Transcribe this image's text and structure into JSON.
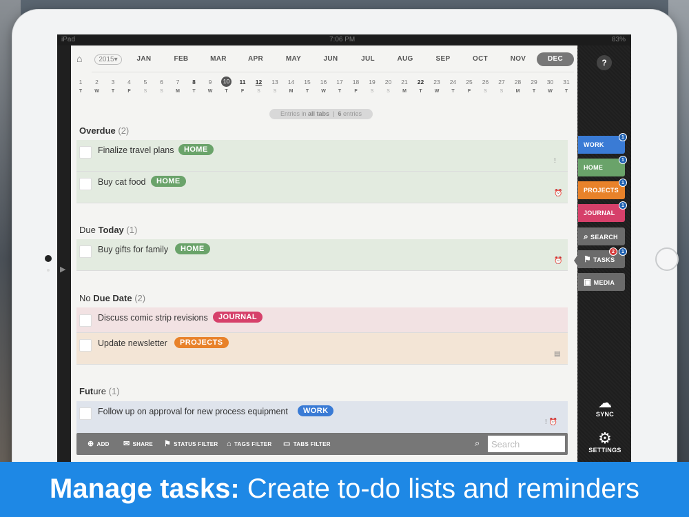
{
  "status": {
    "left": "iPad",
    "time": "7:06 PM",
    "right": "83%"
  },
  "calendar": {
    "home_icon": "home-icon",
    "year": "2015",
    "months": [
      "JAN",
      "FEB",
      "MAR",
      "APR",
      "MAY",
      "JUN",
      "JUL",
      "AUG",
      "SEP",
      "OCT",
      "NOV",
      "DEC"
    ],
    "active_month": "DEC",
    "days": [
      {
        "n": "1",
        "w": "T"
      },
      {
        "n": "2",
        "w": "W"
      },
      {
        "n": "3",
        "w": "T"
      },
      {
        "n": "4",
        "w": "F"
      },
      {
        "n": "5",
        "w": "S"
      },
      {
        "n": "6",
        "w": "S"
      },
      {
        "n": "7",
        "w": "M"
      },
      {
        "n": "8",
        "w": "T"
      },
      {
        "n": "9",
        "w": "W"
      },
      {
        "n": "10",
        "w": "T"
      },
      {
        "n": "11",
        "w": "F"
      },
      {
        "n": "12",
        "w": "S"
      },
      {
        "n": "13",
        "w": "S"
      },
      {
        "n": "14",
        "w": "M"
      },
      {
        "n": "15",
        "w": "T"
      },
      {
        "n": "16",
        "w": "W"
      },
      {
        "n": "17",
        "w": "T"
      },
      {
        "n": "18",
        "w": "F"
      },
      {
        "n": "19",
        "w": "S"
      },
      {
        "n": "20",
        "w": "S"
      },
      {
        "n": "21",
        "w": "M"
      },
      {
        "n": "22",
        "w": "T"
      },
      {
        "n": "23",
        "w": "W"
      },
      {
        "n": "24",
        "w": "T"
      },
      {
        "n": "25",
        "w": "F"
      },
      {
        "n": "26",
        "w": "S"
      },
      {
        "n": "27",
        "w": "S"
      },
      {
        "n": "28",
        "w": "M"
      },
      {
        "n": "29",
        "w": "T"
      },
      {
        "n": "30",
        "w": "W"
      },
      {
        "n": "31",
        "w": "T"
      }
    ]
  },
  "entries": {
    "prefix": "Entries in",
    "scope": "all tabs",
    "sep": "|",
    "count": "6",
    "suffix": "entries"
  },
  "sections": {
    "overdue": {
      "label": "Overdue",
      "count": "(2)"
    },
    "due_today": {
      "label_plain": "Due ",
      "label_bold": "Today",
      "count": "(1)"
    },
    "no_due": {
      "label_plain": "No ",
      "label_bold": "Due Date",
      "count": "(2)"
    },
    "future": {
      "label_bold": "Fut",
      "label_plain": "ure",
      "count": "(1)"
    }
  },
  "tasks": [
    {
      "title": "Finalize travel plans",
      "tag": "HOME",
      "icons": "!"
    },
    {
      "title": "Buy cat food",
      "tag": "HOME",
      "icons": "⏰"
    },
    {
      "title": "Buy gifts for family",
      "tag": "HOME",
      "icons": "⏰"
    },
    {
      "title": "Discuss comic strip revisions",
      "tag": "JOURNAL",
      "icons": ""
    },
    {
      "title": "Update newsletter",
      "tag": "PROJECTS",
      "icons": "▤"
    },
    {
      "title": "Follow up on approval for new process equipment",
      "tag": "WORK",
      "icons": "! ⏰"
    }
  ],
  "toolbar": {
    "add": "ADD",
    "share": "SHARE",
    "status_filter": "STATUS FILTER",
    "tags_filter": "TAGS FILTER",
    "tabs_filter": "TABS FILTER",
    "search_placeholder": "Search"
  },
  "right_tabs": {
    "help": "?",
    "work": "WORK",
    "home": "HOME",
    "projects": "PROJECTS",
    "journal": "JOURNAL",
    "search": "SEARCH",
    "tasks": "TASKS",
    "media": "MEDIA",
    "badges": {
      "work": "1",
      "home": "1",
      "projects": "1",
      "journal": "1",
      "tasks_red": "2",
      "tasks_blue": "1"
    },
    "sync": "SYNC",
    "settings": "SETTINGS"
  },
  "banner": {
    "bold": "Manage tasks:",
    "rest": " Create to-do lists and reminders"
  },
  "colors": {
    "home": "#6aa36a",
    "journal": "#d6406a",
    "projects": "#e8822a",
    "work": "#3a7bd5",
    "banner": "#1e88e5"
  }
}
